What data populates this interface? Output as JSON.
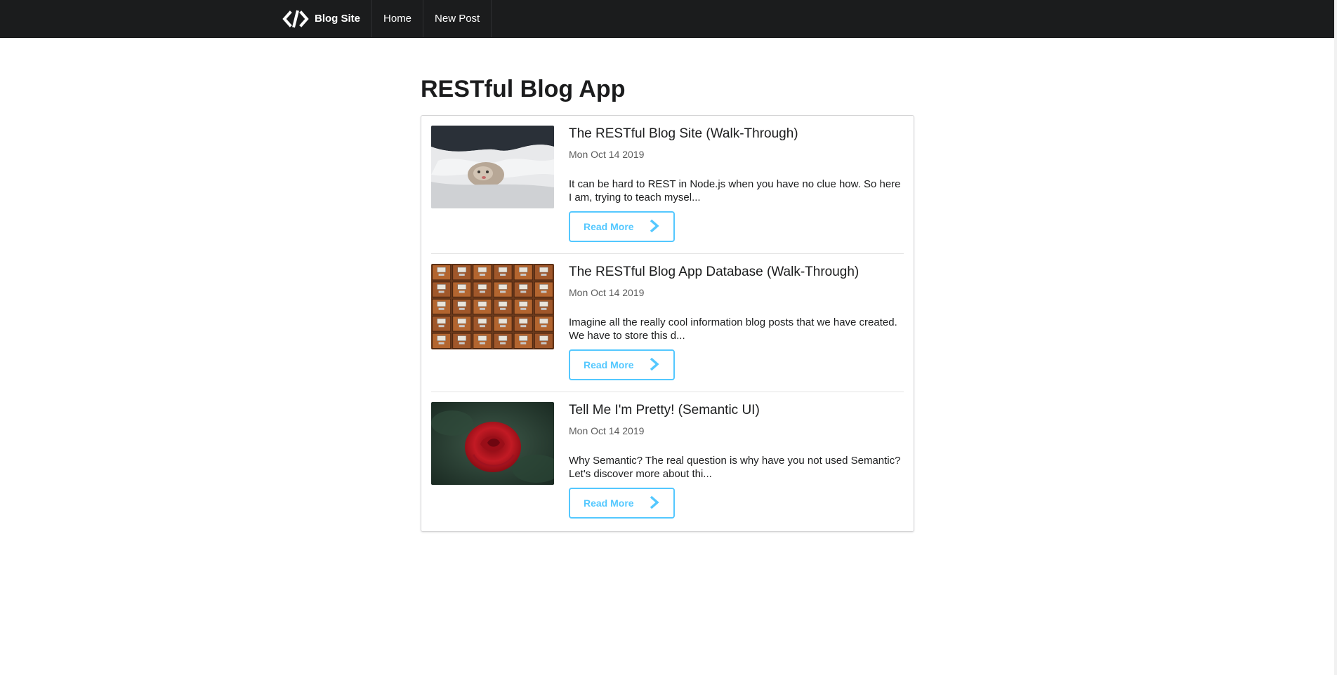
{
  "nav": {
    "brand_label": "Blog Site",
    "brand_icon": "code-icon",
    "items": [
      {
        "label": "Home"
      },
      {
        "label": "New Post"
      }
    ]
  },
  "page": {
    "title": "RESTful Blog App"
  },
  "posts": [
    {
      "title": "The RESTful Blog Site (Walk-Through)",
      "date": "Mon Oct 14 2019",
      "excerpt": "It can be hard to REST in Node.js when you have no clue how. So here I am, trying to teach mysel...",
      "button": "Read More",
      "image": "kitten-in-bedsheets"
    },
    {
      "title": "The RESTful Blog App Database (Walk-Through)",
      "date": "Mon Oct 14 2019",
      "excerpt": "Imagine all the really cool information blog posts that we have created. We have to store this d...",
      "button": "Read More",
      "image": "card-catalog-drawers"
    },
    {
      "title": "Tell Me I'm Pretty! (Semantic UI)",
      "date": "Mon Oct 14 2019",
      "excerpt": "Why Semantic? The real question is why have you not used Semantic? Let's discover more about thi...",
      "button": "Read More",
      "image": "red-rose"
    }
  ],
  "colors": {
    "navbar": "#1b1c1d",
    "accent": "#54c8ff"
  }
}
